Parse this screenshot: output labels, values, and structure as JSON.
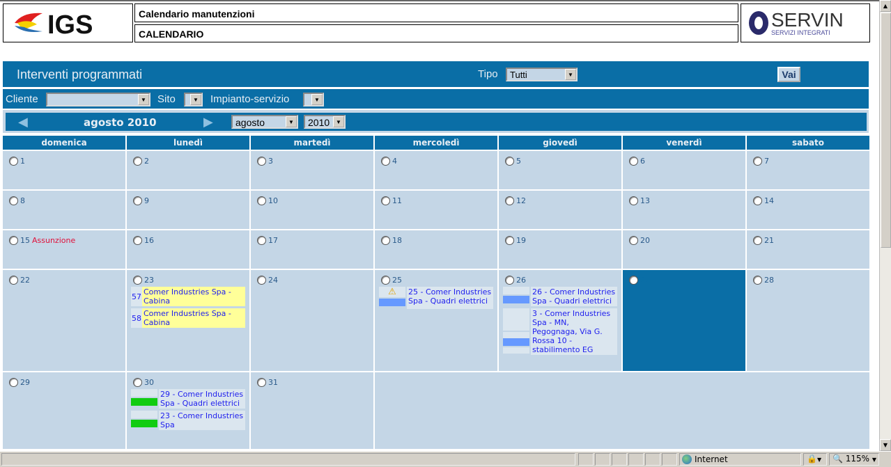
{
  "header": {
    "logo_left": "IGS",
    "title": "Calendario manutenzioni",
    "subtitle": "CALENDARIO",
    "logo_right": "SERVIN",
    "logo_right_sub": "SERVIZI INTEGRATI"
  },
  "toolbar": {
    "heading": "Interventi programmati",
    "tipo_label": "Tipo",
    "tipo_value": "Tutti",
    "go_label": "Vai"
  },
  "filters": {
    "cliente_label": "Cliente",
    "cliente_value": "",
    "sito_label": "Sito",
    "impianto_label": "Impianto-servizio"
  },
  "nav": {
    "current": "agosto 2010",
    "month_value": "agosto",
    "year_value": "2010"
  },
  "weekdays": [
    "domenica",
    "lunedì",
    "martedì",
    "mercoledì",
    "giovedì",
    "venerdì",
    "sabato"
  ],
  "days": {
    "d15_holiday": "Assunzione"
  },
  "events": {
    "e57": {
      "num": "57",
      "text": "Comer Industries Spa - Cabina"
    },
    "e58": {
      "num": "58",
      "text": "Comer Industries Spa - Cabina"
    },
    "e25": {
      "text": "25 - Comer Industries Spa - Quadri elettrici"
    },
    "e26": {
      "text": "26 - Comer Industries Spa - Quadri elettrici"
    },
    "e3": {
      "text": "3 - Comer Industries Spa - MN, Pegognaga, Via G. Rossa 10 - stabilimento EG"
    },
    "e29": {
      "text": "29 - Comer Industries Spa - Quadri elettrici"
    },
    "e23": {
      "text": "23 - Comer Industries Spa"
    }
  },
  "colors": {
    "primary": "#0a6ea6",
    "cell": "#c4d6e6",
    "selected_day": "#0a6ea6",
    "status_blue": "#6699ff",
    "status_green": "#11cc11",
    "highlight": "#ffff99",
    "holiday": "#e0103a"
  },
  "statusbar": {
    "zone": "Internet",
    "zoom": "115%"
  }
}
